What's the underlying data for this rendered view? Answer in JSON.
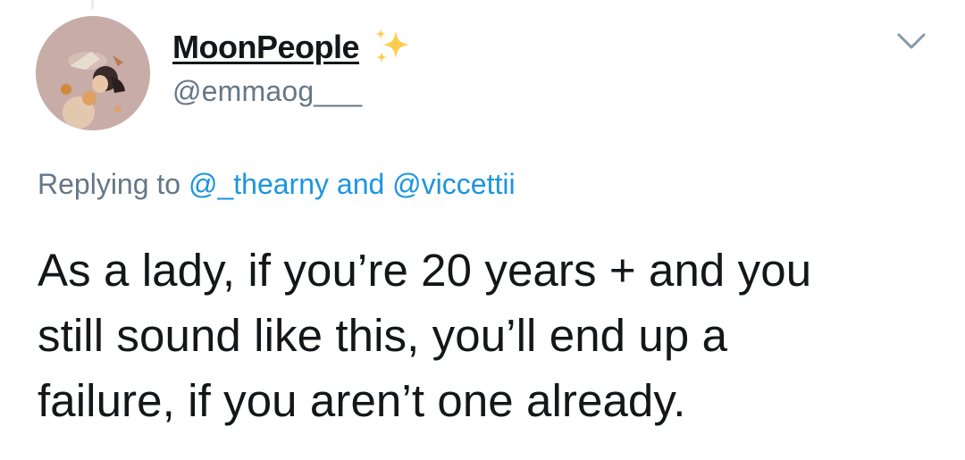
{
  "tweet": {
    "author": {
      "display_name": "MoonPeople",
      "handle": "@emmaog___",
      "name_emoji": "sparkles-icon",
      "avatar": "avatar"
    },
    "reply": {
      "prefix": "Replying to",
      "mention_1": "@_thearny",
      "conjunction": "and",
      "mention_2": "@viccettii"
    },
    "text_lines": [
      "As a lady, if you’re 20 years + and you",
      "still sound like this, you’ll end up a",
      "failure, if you aren’t one already."
    ],
    "menu_icon": "chevron-down-icon"
  },
  "colors": {
    "text_primary": "#14171a",
    "text_secondary": "#657786",
    "link": "#1b95e0",
    "sparkle": "#ffcc4d"
  }
}
